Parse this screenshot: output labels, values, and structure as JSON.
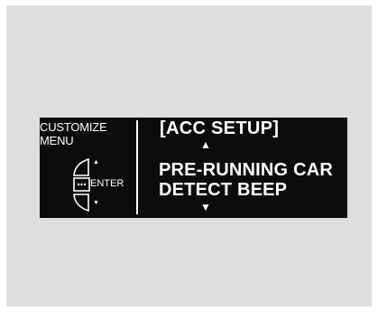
{
  "menu": {
    "title_line1": "CUSTOMIZE",
    "title_line2": "MENU",
    "enter_label": "ENTER",
    "knob_up_arrow": "▲",
    "knob_down_arrow": "▼",
    "knob_icon": "selector-knob-icon"
  },
  "screen": {
    "header": "[ACC SETUP]",
    "up_arrow": "▲",
    "item_line1": "PRE-RUNNING CAR",
    "item_line2": "DETECT BEEP",
    "down_arrow": "▼"
  },
  "colors": {
    "background": "#dedede",
    "display": "#0c0c0c",
    "text": "#ffffff"
  }
}
